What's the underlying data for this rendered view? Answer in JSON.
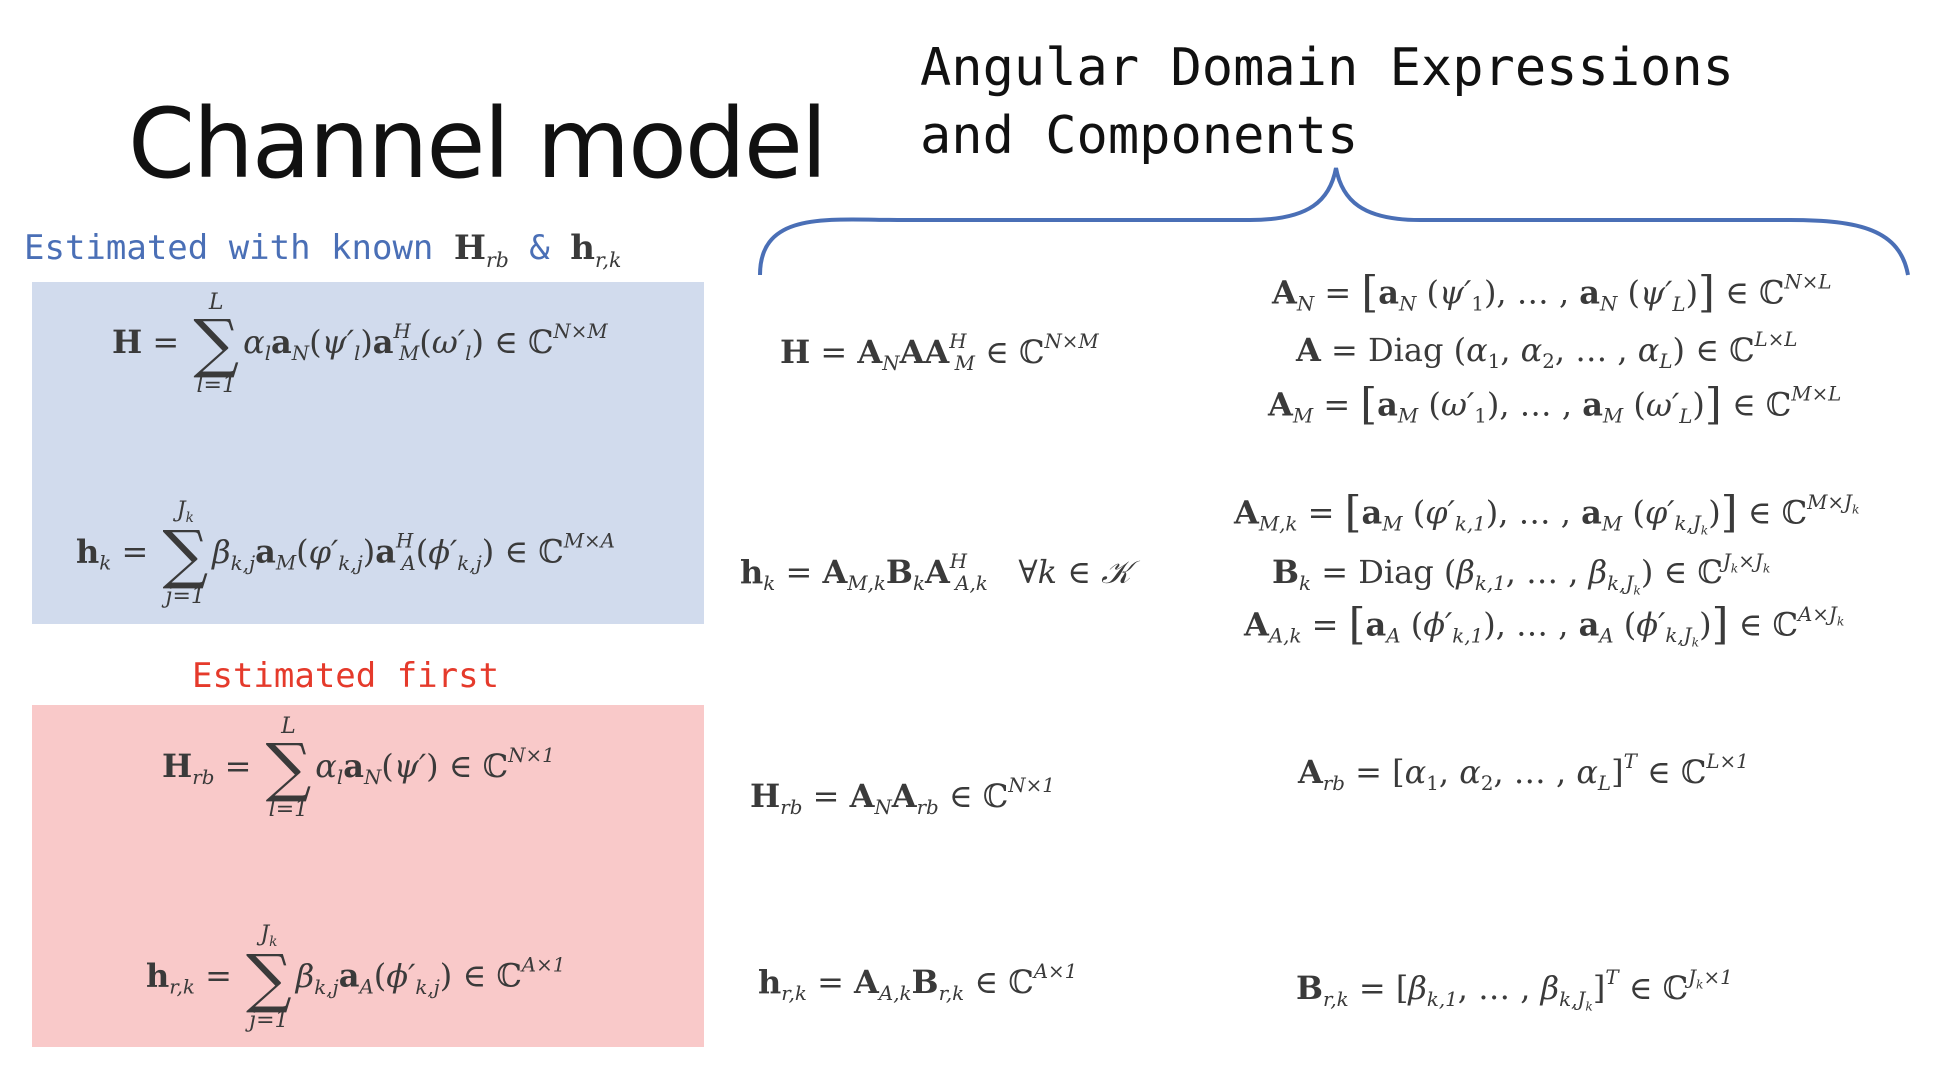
{
  "title": "Channel model",
  "heading": {
    "line1": "Angular Domain Expressions",
    "line2": "and Components"
  },
  "labels": {
    "estimated_known_prefix": "Estimated with known ",
    "estimated_known_hrb": "H",
    "estimated_known_hrb_sub": "rb",
    "estimated_known_amp": " & ",
    "estimated_known_hrk": "h",
    "estimated_known_hrk_sub": "r,k",
    "estimated_first": "Estimated first"
  },
  "colors": {
    "blue_panel": "#d1dbed",
    "red_panel": "#f9c9c9",
    "blue_text": "#4a6fb6",
    "red_text": "#e53a2b",
    "brace": "#4a6fb6"
  }
}
